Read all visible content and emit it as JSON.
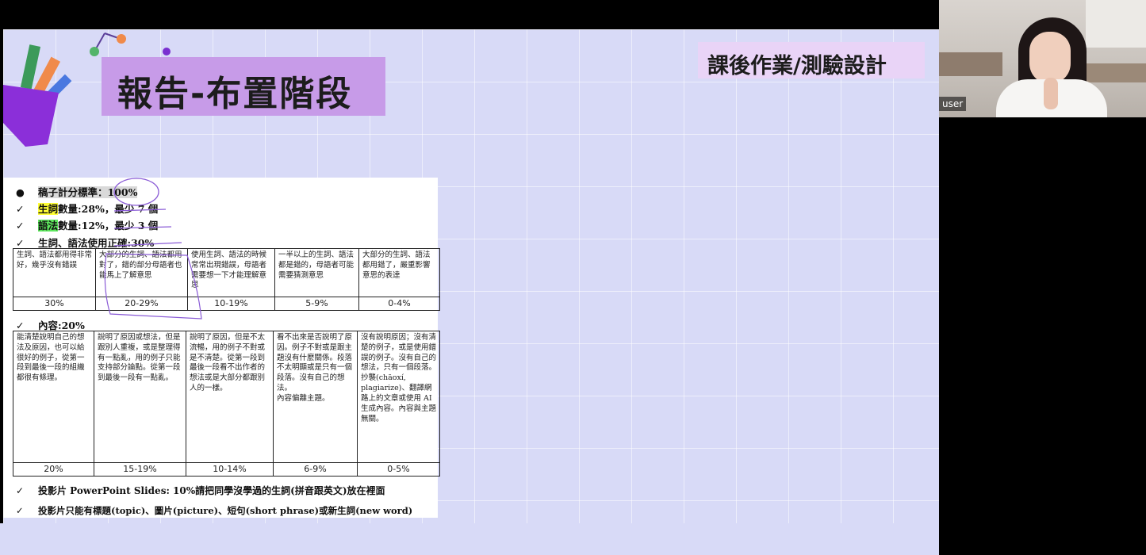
{
  "slide": {
    "title": "報告-布置階段",
    "corner_tag": "課後作業/測驗設計"
  },
  "doc": {
    "bullets": {
      "b1_mark": "●",
      "b1": "稿子計分標準：100%",
      "b2_mark": "✓",
      "b2a": "生詞",
      "b2b": "數量:28%，最少 7 個",
      "b3_mark": "✓",
      "b3a": "語法",
      "b3b": "數量:12%，最少 3 個",
      "b4_mark": "✓",
      "b4": "生詞、語法使用正確:30%",
      "b5_mark": "✓",
      "b5": "內容:20%",
      "b6_mark": "✓",
      "b6": "投影片 PowerPoint Slides: 10%請把同學沒學過的生詞(拼音跟英文)放在裡面",
      "b7_mark": "✓",
      "b7": "投影片只能有標題(topic)、圖片(picture)、短句(short phrase)或新生詞(new word)"
    },
    "table1": {
      "desc": [
        "生詞、語法都用得非常好，幾乎沒有錯誤",
        "大部分的生詞、語法都用對了，錯的部分母語者也能馬上了解意思",
        "使用生詞、語法的時候常常出現錯誤，母語者需要想一下才能理解意思",
        "一半以上的生詞、語法都是錯的，母語者可能需要猜測意思",
        "大部分的生詞、語法都用錯了，嚴重影響意思的表達"
      ],
      "scores": [
        "30%",
        "20-29%",
        "10-19%",
        "5-9%",
        "0-4%"
      ]
    },
    "table2": {
      "desc": [
        "能清楚說明自己的想法及原因，也可以給很好的例子，從第一段到最後一段的組織都很有條理。",
        "說明了原因或想法，但是跟別人重複，或是整理得有一點亂，用的例子只能支持部分論點。從第一段到最後一段有一點亂。",
        "說明了原因，但是不太流暢，用的例子不對或是不清楚。從第一段到最後一段看不出作者的想法或是大部分都跟別人的一樣。",
        "看不出來是否說明了原因。例子不對或是跟主題沒有什麼關係。段落不太明顯或是只有一個段落。沒有自己的想法。\n內容偏離主題。",
        "沒有說明原因；沒有清楚的例子，或是使用錯誤的例子。沒有自己的想法，只有一個段落。\n抄襲(chāoxí, plagiarize)、翻譯網路上的文章或使用 AI 生成內容。內容與主題無關。"
      ],
      "scores": [
        "20%",
        "15-19%",
        "10-14%",
        "6-9%",
        "0-5%"
      ]
    }
  },
  "webcam": {
    "label": "user"
  },
  "colors": {
    "slide_bg": "#d8daf7",
    "title_bg": "#c79be8",
    "tag_bg": "#e9d4f7",
    "ink": "#8a5bd6"
  }
}
